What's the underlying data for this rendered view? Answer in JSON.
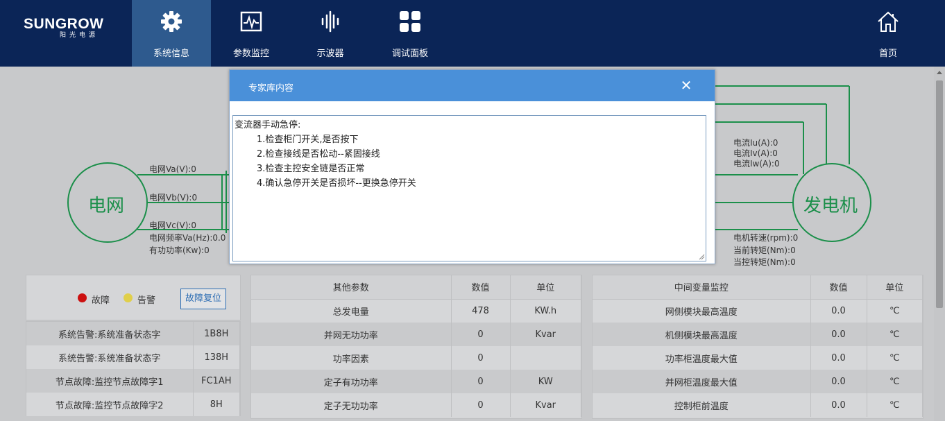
{
  "nav": {
    "logo_brand": "SUNGROW",
    "logo_sub": "阳光电源",
    "items": [
      {
        "label": "系统信息",
        "icon": "gear-icon",
        "active": true
      },
      {
        "label": "参数监控",
        "icon": "monitor-chart-icon",
        "active": false
      },
      {
        "label": "示波器",
        "icon": "waveform-icon",
        "active": false
      },
      {
        "label": "调试面板",
        "icon": "grid-panel-icon",
        "active": false
      },
      {
        "label": "首页",
        "icon": "home-icon",
        "active": false
      }
    ]
  },
  "diagram": {
    "grid_label": "电网",
    "generator_label": "发电机",
    "grid_va": "电网Va(V):0",
    "grid_vb": "电网Vb(V):0",
    "grid_vc": "电网Vc(V):0",
    "grid_freq": "电网频率Va(Hz):0.0",
    "active_power": "有功功率(Kw):0",
    "iu": "电流Iu(A):0",
    "iv": "电流Iv(A):0",
    "iw": "电流Iw(A):0",
    "motor_speed": "电机转速(rpm):0",
    "front_torque": "当前转矩(Nm):0",
    "control_torque": "当控转矩(Nm):0",
    "line_color": "#1b8f4a"
  },
  "status": {
    "fault_label": "故障",
    "alarm_label": "告警",
    "fault_color": "#cc1010",
    "alarm_color": "#e0cf4a",
    "reset_button": "故障复位",
    "rows": [
      {
        "name": "系统告警:系统准备状态字",
        "value": "1B8H"
      },
      {
        "name": "系统告警:系统准备状态字",
        "value": "138H"
      },
      {
        "name": "节点故障:监控节点故障字1",
        "value": "FC1AH"
      },
      {
        "name": "节点故障:监控节点故障字2",
        "value": "8H"
      }
    ]
  },
  "other_params": {
    "headers": [
      "其他参数",
      "数值",
      "单位"
    ],
    "rows": [
      {
        "name": "总发电量",
        "value": "478",
        "unit": "KW.h"
      },
      {
        "name": "并网无功功率",
        "value": "0",
        "unit": "Kvar"
      },
      {
        "name": "功率因素",
        "value": "0",
        "unit": ""
      },
      {
        "name": "定子有功功率",
        "value": "0",
        "unit": "KW"
      },
      {
        "name": "定子无功功率",
        "value": "0",
        "unit": "Kvar"
      }
    ]
  },
  "intermediate": {
    "headers": [
      "中间变量监控",
      "数值",
      "单位"
    ],
    "rows": [
      {
        "name": "网侧模块最高温度",
        "value": "0.0",
        "unit": "℃"
      },
      {
        "name": "机侧模块最高温度",
        "value": "0.0",
        "unit": "℃"
      },
      {
        "name": "功率柜温度最大值",
        "value": "0.0",
        "unit": "℃"
      },
      {
        "name": "并网柜温度最大值",
        "value": "0.0",
        "unit": "℃"
      },
      {
        "name": "控制柜前温度",
        "value": "0.0",
        "unit": "℃"
      }
    ]
  },
  "modal": {
    "title": "专家库内容",
    "close": "✕",
    "heading": "变流器手动急停:",
    "steps": [
      "1.检查柜门开关,是否按下",
      "2.检查接线是否松动--紧固接线",
      "3.检查主控安全链是否正常",
      "4.确认急停开关是否损坏--更换急停开关"
    ]
  }
}
